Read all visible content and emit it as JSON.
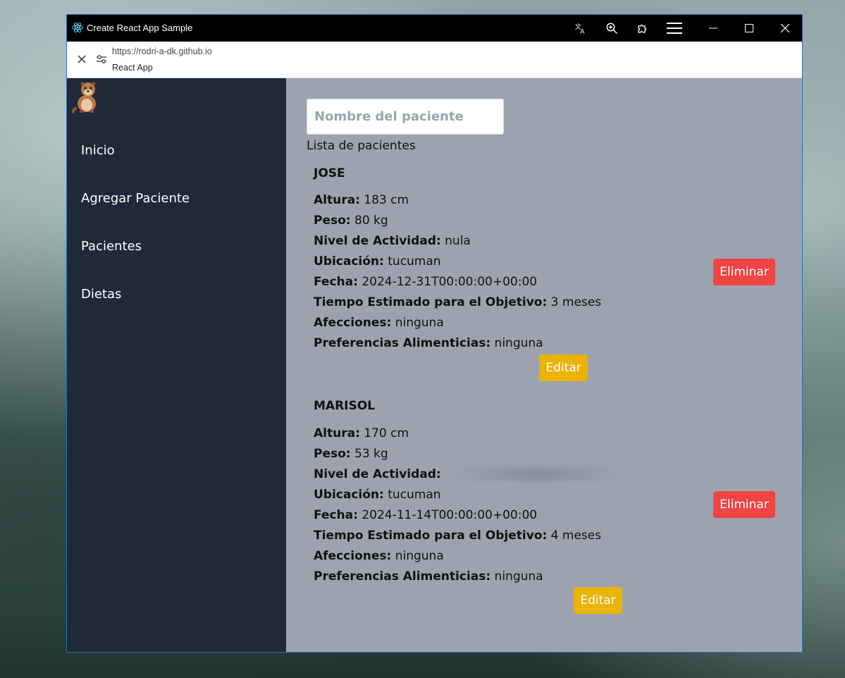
{
  "window": {
    "title": "Create React App Sample",
    "url": "https://rodri-a-dk.github.io",
    "page_title": "React App"
  },
  "sidebar": {
    "items": [
      {
        "label": "Inicio"
      },
      {
        "label": "Agregar Paciente"
      },
      {
        "label": "Pacientes"
      },
      {
        "label": "Dietas"
      }
    ]
  },
  "main": {
    "search_placeholder": "Nombre del paciente",
    "list_title": "Lista de pacientes",
    "field_labels": {
      "altura": "Altura:",
      "peso": "Peso:",
      "actividad": "Nivel de Actividad:",
      "ubicacion": "Ubicación:",
      "fecha": "Fecha:",
      "tiempo": "Tiempo Estimado para el Objetivo:",
      "afecciones": "Afecciones:",
      "preferencias": "Preferencias Alimenticias:"
    },
    "delete_label": "Eliminar",
    "edit_label": "Editar",
    "patients": [
      {
        "name": "JOSE",
        "altura": "183 cm",
        "peso": "80 kg",
        "actividad": "nula",
        "ubicacion": "tucuman",
        "fecha": "2024-12-31T00:00:00+00:00",
        "tiempo": "3 meses",
        "afecciones": "ninguna",
        "preferencias": "ninguna"
      },
      {
        "name": "MARISOL",
        "altura": "170 cm",
        "peso": "53 kg",
        "actividad": "",
        "ubicacion": "tucuman",
        "fecha": "2024-11-14T00:00:00+00:00",
        "tiempo": "4 meses",
        "afecciones": "ninguna",
        "preferencias": "ninguna"
      }
    ]
  },
  "colors": {
    "sidebar_bg": "#1f2937",
    "main_bg": "#9ca3af",
    "delete_bg": "#ef4444",
    "edit_bg": "#eab308",
    "titlebar_bg": "#000000"
  },
  "icons": {
    "app": "react-icon",
    "translate": "translate-icon",
    "zoom": "zoom-in-icon",
    "extensions": "puzzle-icon",
    "menu": "hamburger-menu-icon",
    "minimize": "minimize-icon",
    "maximize": "maximize-icon",
    "close": "close-icon",
    "addr_close": "close-icon",
    "site_settings": "tune-icon",
    "logo": "otter-logo"
  }
}
